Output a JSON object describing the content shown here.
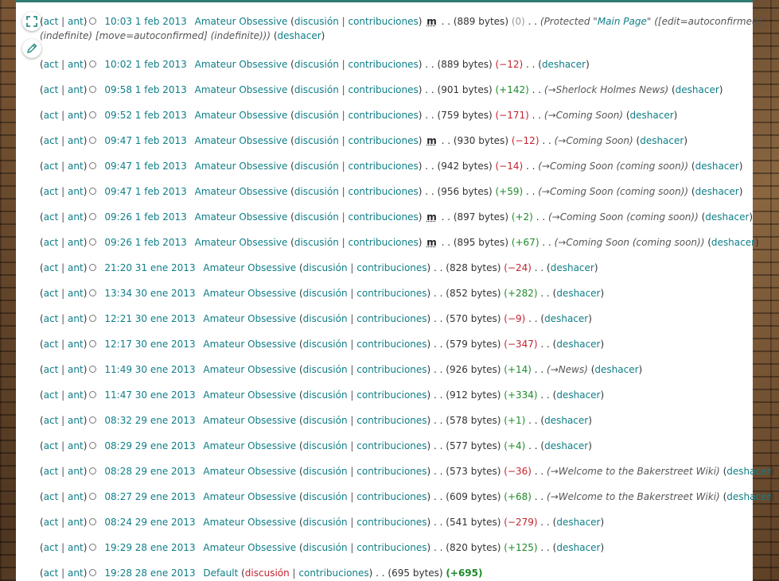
{
  "labels": {
    "act": "act",
    "ant": "ant",
    "talk": "discusión",
    "contribs": "contribuciones",
    "undo": "deshacer",
    "minor": "m",
    "bytes_suffix": " bytes"
  },
  "toolbar": {
    "fullscreen_icon": "fullscreen-icon",
    "edit_icon": "pencil-icon"
  },
  "colors": {
    "accent": "#0f7e87",
    "negative": "#c3232f",
    "positive": "#1f8a2a"
  },
  "rows": [
    {
      "time": "10:03 1 feb 2013",
      "user": "Amateur Obsessive",
      "minor": true,
      "size": "889",
      "diff": "(0)",
      "diff_class": "zero",
      "summary_pre": "(Protected \"",
      "summary_link": "Main Page",
      "summary_post": "\" ([edit=autoconfirmed]",
      "summary_line2": "(indefinite) [move=autoconfirmed] (indefinite)))",
      "undo": true
    },
    {
      "time": "10:02 1 feb 2013",
      "user": "Amateur Obsessive",
      "minor": false,
      "size": "889",
      "diff": "(−12)",
      "diff_class": "neg",
      "summary": "",
      "undo": true
    },
    {
      "time": "09:58 1 feb 2013",
      "user": "Amateur Obsessive",
      "minor": false,
      "size": "901",
      "diff": "(+142)",
      "diff_class": "pos",
      "summary": "(→Sherlock Holmes News)",
      "undo": true
    },
    {
      "time": "09:52 1 feb 2013",
      "user": "Amateur Obsessive",
      "minor": false,
      "size": "759",
      "diff": "(−171)",
      "diff_class": "neg",
      "summary": "(→Coming Soon)",
      "undo": true
    },
    {
      "time": "09:47 1 feb 2013",
      "user": "Amateur Obsessive",
      "minor": true,
      "size": "930",
      "diff": "(−12)",
      "diff_class": "neg",
      "summary": "(→Coming Soon)",
      "undo": true
    },
    {
      "time": "09:47 1 feb 2013",
      "user": "Amateur Obsessive",
      "minor": false,
      "size": "942",
      "diff": "(−14)",
      "diff_class": "neg",
      "summary": "(→Coming Soon (coming soon))",
      "undo": true
    },
    {
      "time": "09:47 1 feb 2013",
      "user": "Amateur Obsessive",
      "minor": false,
      "size": "956",
      "diff": "(+59)",
      "diff_class": "pos",
      "summary": "(→Coming Soon (coming soon))",
      "undo": true
    },
    {
      "time": "09:26 1 feb 2013",
      "user": "Amateur Obsessive",
      "minor": true,
      "size": "897",
      "diff": "(+2)",
      "diff_class": "pos",
      "summary": "(→Coming Soon (coming soon))",
      "undo": true
    },
    {
      "time": "09:26 1 feb 2013",
      "user": "Amateur Obsessive",
      "minor": true,
      "size": "895",
      "diff": "(+67)",
      "diff_class": "pos",
      "summary": "(→Coming Soon (coming soon))",
      "undo": true
    },
    {
      "time": "21:20 31 ene 2013",
      "user": "Amateur Obsessive",
      "minor": false,
      "size": "828",
      "diff": "(−24)",
      "diff_class": "neg",
      "summary": "",
      "undo": true
    },
    {
      "time": "13:34 30 ene 2013",
      "user": "Amateur Obsessive",
      "minor": false,
      "size": "852",
      "diff": "(+282)",
      "diff_class": "pos",
      "summary": "",
      "undo": true
    },
    {
      "time": "12:21 30 ene 2013",
      "user": "Amateur Obsessive",
      "minor": false,
      "size": "570",
      "diff": "(−9)",
      "diff_class": "neg",
      "summary": "",
      "undo": true
    },
    {
      "time": "12:17 30 ene 2013",
      "user": "Amateur Obsessive",
      "minor": false,
      "size": "579",
      "diff": "(−347)",
      "diff_class": "neg",
      "summary": "",
      "undo": true
    },
    {
      "time": "11:49 30 ene 2013",
      "user": "Amateur Obsessive",
      "minor": false,
      "size": "926",
      "diff": "(+14)",
      "diff_class": "pos",
      "summary": "(→News)",
      "undo": true
    },
    {
      "time": "11:47 30 ene 2013",
      "user": "Amateur Obsessive",
      "minor": false,
      "size": "912",
      "diff": "(+334)",
      "diff_class": "pos",
      "summary": "",
      "undo": true
    },
    {
      "time": "08:32 29 ene 2013",
      "user": "Amateur Obsessive",
      "minor": false,
      "size": "578",
      "diff": "(+1)",
      "diff_class": "pos",
      "summary": "",
      "undo": true
    },
    {
      "time": "08:29 29 ene 2013",
      "user": "Amateur Obsessive",
      "minor": false,
      "size": "577",
      "diff": "(+4)",
      "diff_class": "pos",
      "summary": "",
      "undo": true
    },
    {
      "time": "08:28 29 ene 2013",
      "user": "Amateur Obsessive",
      "minor": false,
      "size": "573",
      "diff": "(−36)",
      "diff_class": "neg",
      "summary": "(→Welcome to the Bakerstreet Wiki)",
      "undo": true
    },
    {
      "time": "08:27 29 ene 2013",
      "user": "Amateur Obsessive",
      "minor": false,
      "size": "609",
      "diff": "(+68)",
      "diff_class": "pos",
      "summary": "(→Welcome to the Bakerstreet Wiki)",
      "undo": true
    },
    {
      "time": "08:24 29 ene 2013",
      "user": "Amateur Obsessive",
      "minor": false,
      "size": "541",
      "diff": "(−279)",
      "diff_class": "neg",
      "summary": "",
      "undo": true
    },
    {
      "time": "19:29 28 ene 2013",
      "user": "Amateur Obsessive",
      "minor": false,
      "size": "820",
      "diff": "(+125)",
      "diff_class": "pos",
      "summary": "",
      "undo": true
    },
    {
      "time": "19:28 28 ene 2013",
      "user": "Default",
      "minor": false,
      "size": "695",
      "diff": "(+695)",
      "diff_class": "pos big",
      "summary": "",
      "undo": false,
      "talk_red": true
    }
  ]
}
